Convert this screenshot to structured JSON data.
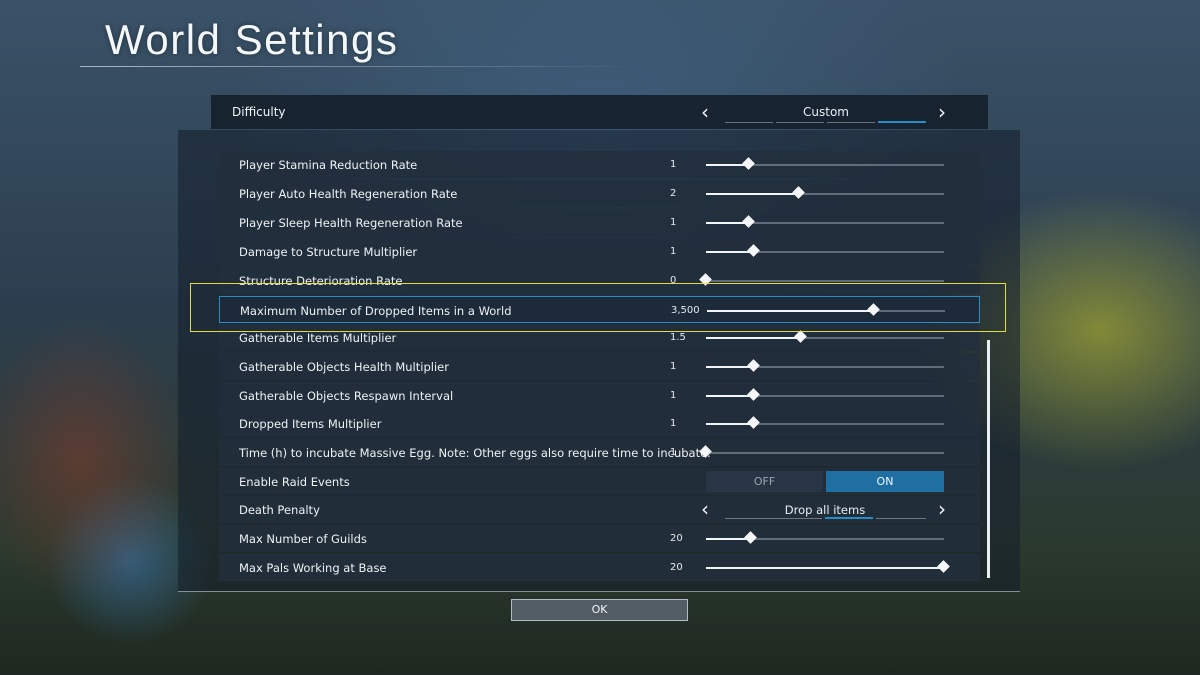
{
  "title": "World Settings",
  "difficulty": {
    "label": "Difficulty",
    "value": "Custom",
    "prev_icon": "chevron-left",
    "next_icon": "chevron-right"
  },
  "settings": [
    {
      "label": "Player Stamina Reduction Rate",
      "value": "1",
      "fraction": 0.18
    },
    {
      "label": "Player Auto Health Regeneration Rate",
      "value": "2",
      "fraction": 0.39
    },
    {
      "label": "Player Sleep Health Regeneration Rate",
      "value": "1",
      "fraction": 0.18
    },
    {
      "label": "Damage to Structure Multiplier",
      "value": "1",
      "fraction": 0.2
    },
    {
      "label": "Structure Deterioration Rate",
      "value": "0",
      "fraction": 0.0
    },
    {
      "label": "Maximum Number of Dropped Items in a World",
      "value": "3,500",
      "fraction": 0.7
    },
    {
      "label": "Gatherable Items Multiplier",
      "value": "1.5",
      "fraction": 0.4
    },
    {
      "label": "Gatherable Objects Health Multiplier",
      "value": "1",
      "fraction": 0.2
    },
    {
      "label": "Gatherable Objects Respawn Interval",
      "value": "1",
      "fraction": 0.2
    },
    {
      "label": "Dropped Items Multiplier",
      "value": "1",
      "fraction": 0.2
    },
    {
      "label": "Time (h) to incubate Massive Egg. Note: Other eggs also require time to incubate.",
      "value": "1",
      "fraction": 0.0
    }
  ],
  "raid": {
    "label": "Enable Raid Events",
    "off_label": "OFF",
    "on_label": "ON",
    "selected": "ON"
  },
  "death_penalty": {
    "label": "Death Penalty",
    "value": "Drop all items"
  },
  "guilds": {
    "label": "Max Number of Guilds",
    "value": "20",
    "fraction": 0.19
  },
  "pals_base": {
    "label": "Max Pals Working at Base",
    "value": "20",
    "fraction": 1.0
  },
  "ok_label": "OK"
}
